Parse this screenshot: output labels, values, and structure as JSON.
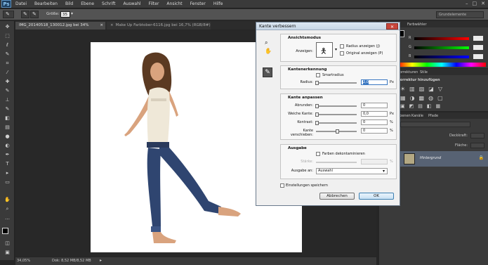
{
  "menu": {
    "logo": "Ps",
    "items": [
      "Datei",
      "Bearbeiten",
      "Bild",
      "Ebene",
      "Schrift",
      "Auswahl",
      "Filter",
      "Ansicht",
      "Fenster",
      "Hilfe"
    ]
  },
  "options": {
    "size_label": "Größe:",
    "size_value": "35",
    "workspace": "Grundelemente"
  },
  "tabs": [
    {
      "label": "IMG_20140518_130012.jpg bei 34% (RGB/8#)",
      "active": true
    },
    {
      "label": "Make Up Farbtober-6116.jpg bei 16,7% (RGB/8#)",
      "active": false
    }
  ],
  "status": {
    "zoom": "34,05%",
    "doc": "Dok: 8,52 MB/8,52 MB"
  },
  "right_panel": {
    "color_tab": "Farbwähler",
    "channels": [
      "R",
      "G",
      "B"
    ],
    "correction_tab": "Korrekturen",
    "styles_tab": "Stile",
    "correction_title": "Korrektur hinzufügen",
    "layers_tabs": [
      "Ebenen",
      "Kanäle",
      "Pfade"
    ],
    "opacity_label": "Deckkraft:",
    "fill_label": "Fläche:",
    "layer_name": "Hintergrund"
  },
  "dialog": {
    "title": "Kante verbessern",
    "view_mode": {
      "title": "Ansichtsmodus",
      "view_label": "Anzeigen:",
      "show_radius": "Radius anzeigen (J)",
      "show_original": "Original anzeigen (P)"
    },
    "edge_detection": {
      "title": "Kantenerkennung",
      "smart_radius": "Smartradius",
      "radius_label": "Radius:",
      "radius_value": "2,0",
      "radius_unit": "Px"
    },
    "adjust_edge": {
      "title": "Kante anpassen",
      "smooth_label": "Abrunden:",
      "smooth_value": "0",
      "feather_label": "Weiche Kante:",
      "feather_value": "0,0",
      "feather_unit": "Px",
      "contrast_label": "Kontrast:",
      "contrast_value": "0",
      "contrast_unit": "%",
      "shift_label": "Kante verschieben:",
      "shift_value": "0",
      "shift_unit": "%"
    },
    "output": {
      "title": "Ausgabe",
      "decontaminate": "Farben dekontaminieren",
      "amount_label": "Stärke:",
      "amount_unit": "%",
      "output_to_label": "Ausgabe an:",
      "output_to_value": "Auswahl"
    },
    "remember": "Einstellungen speichern",
    "cancel": "Abbrechen",
    "ok": "OK"
  }
}
